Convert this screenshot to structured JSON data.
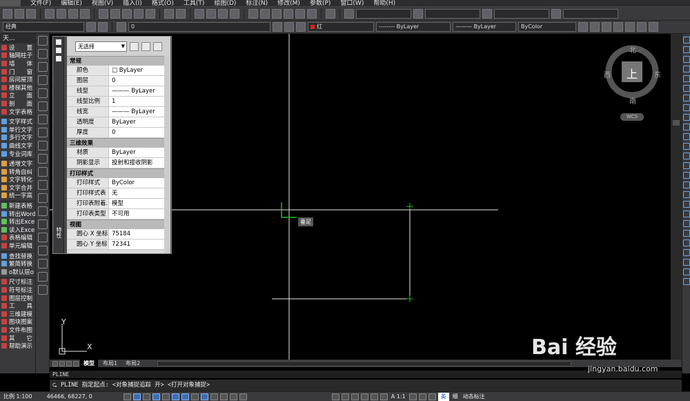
{
  "menu": {
    "items": [
      "文件(F)",
      "编辑(E)",
      "视图(V)",
      "插入(I)",
      "格式(O)",
      "工具(T)",
      "绘图(D)",
      "标注(N)",
      "修改(M)",
      "参数(P)",
      "窗口(W)",
      "帮助(H)"
    ]
  },
  "toolbar2": {
    "workspace": "经典",
    "layer_value": "0",
    "color": "红",
    "linetype": "-------- ByLayer",
    "lineweight": "——— ByLayer",
    "plotstyle": "ByColor"
  },
  "left_palette": {
    "title": "天...",
    "items": [
      {
        "label": "设　　置",
        "color": "#c84040"
      },
      {
        "label": "轴网柱子",
        "color": "#c84040"
      },
      {
        "label": "墙　　体",
        "color": "#c84040"
      },
      {
        "label": "门　　窗",
        "color": "#c84040"
      },
      {
        "label": "房间屋顶",
        "color": "#c84040"
      },
      {
        "label": "楼梯其他",
        "color": "#c84040"
      },
      {
        "label": "立　　面",
        "color": "#c84040"
      },
      {
        "label": "剖　　面",
        "color": "#c84040"
      },
      {
        "label": "文字表格",
        "color": "#c84040"
      },
      {
        "label": "文字样式",
        "color": "#60a0e0"
      },
      {
        "label": "单行文字",
        "color": "#60a0e0"
      },
      {
        "label": "多行文字",
        "color": "#60a0e0"
      },
      {
        "label": "曲线文字",
        "color": "#60a0e0"
      },
      {
        "label": "专业词库",
        "color": "#60a0e0"
      },
      {
        "label": "递增文字",
        "color": "#e0a040"
      },
      {
        "label": "转角自纠",
        "color": "#e0a040"
      },
      {
        "label": "文字转化",
        "color": "#e0a040"
      },
      {
        "label": "文字合并",
        "color": "#e0a040"
      },
      {
        "label": "统一字高",
        "color": "#e0a040"
      },
      {
        "label": "新建表格",
        "color": "#60c060"
      },
      {
        "label": "转出Word",
        "color": "#60a0e0"
      },
      {
        "label": "转出Excel",
        "color": "#60c060"
      },
      {
        "label": "读入Excel",
        "color": "#60c060"
      },
      {
        "label": "表格编辑",
        "color": "#c84040"
      },
      {
        "label": "单元编辑",
        "color": "#c84040"
      },
      {
        "label": "查找替换",
        "color": "#60a0e0"
      },
      {
        "label": "繁简转换",
        "color": "#60a0e0"
      },
      {
        "label": "o默认层o",
        "color": "#999999"
      },
      {
        "label": "尺寸标注",
        "color": "#c84040"
      },
      {
        "label": "符号标注",
        "color": "#c84040"
      },
      {
        "label": "图层控制",
        "color": "#c84040"
      },
      {
        "label": "工　　具",
        "color": "#c84040"
      },
      {
        "label": "三维建模",
        "color": "#c84040"
      },
      {
        "label": "图块图案",
        "color": "#c84040"
      },
      {
        "label": "文件布图",
        "color": "#c84040"
      },
      {
        "label": "其　　它",
        "color": "#c84040"
      },
      {
        "label": "帮助演示",
        "color": "#c84040"
      }
    ]
  },
  "properties": {
    "selection": "无选择",
    "strip_label": "特性",
    "sections": [
      {
        "title": "常规",
        "rows": [
          {
            "k": "颜色",
            "v": "□ ByLayer"
          },
          {
            "k": "图层",
            "v": "0"
          },
          {
            "k": "线型",
            "v": "——— ByLayer"
          },
          {
            "k": "线型比例",
            "v": "1"
          },
          {
            "k": "线宽",
            "v": "——— ByLayer"
          },
          {
            "k": "透明度",
            "v": "ByLayer"
          },
          {
            "k": "厚度",
            "v": "0"
          }
        ]
      },
      {
        "title": "三维效果",
        "rows": [
          {
            "k": "材质",
            "v": "ByLayer"
          },
          {
            "k": "阴影显示",
            "v": "投射和接收阴影"
          }
        ]
      },
      {
        "title": "打印样式",
        "rows": [
          {
            "k": "打印样式",
            "v": "ByColor"
          },
          {
            "k": "打印样式表",
            "v": "无"
          },
          {
            "k": "打印表附着...",
            "v": "模型"
          },
          {
            "k": "打印表类型",
            "v": "不可用"
          }
        ]
      },
      {
        "title": "视图",
        "rows": [
          {
            "k": "圆心 X 坐标",
            "v": "75184"
          },
          {
            "k": "圆心 Y 坐标",
            "v": "72341"
          }
        ]
      }
    ]
  },
  "canvas": {
    "snap_tooltip": "垂足",
    "ucs_y": "Y",
    "ucs_x": "X"
  },
  "compass": {
    "north": "北",
    "south": "南",
    "east": "东",
    "west": "西",
    "top": "上",
    "wcs": "WCS"
  },
  "tabs": [
    "模型",
    "布局1",
    "布局2"
  ],
  "command": {
    "history": "PLINE",
    "prompt": "PLINE 指定起点: <对象捕捉追踪 开>  <打开对象捕捉>"
  },
  "status": {
    "scale": "比例 1:100",
    "coords": "46466, 68227, 0",
    "ime": "英",
    "right_text": "细",
    "right_text2": "动态标注",
    "anno_scale": "A 1:1"
  },
  "watermark": {
    "logo": "Bai 经验",
    "url": "jingyan.baidu.com"
  }
}
